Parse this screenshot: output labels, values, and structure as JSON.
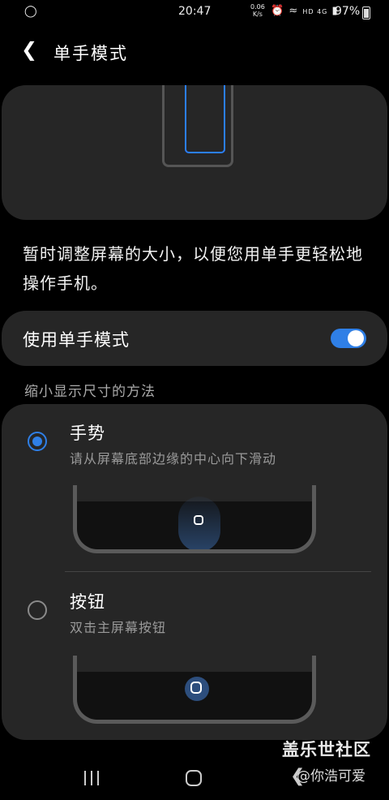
{
  "status_bar": {
    "time": "20:47",
    "network_speed_value": "0.06",
    "network_speed_unit": "K/s",
    "network_label": "HD 4G",
    "battery": "97%",
    "icons": [
      "notification-app-icon",
      "alarm-icon",
      "mute-icon",
      "wifi-icon",
      "signal-icon",
      "battery-icon"
    ]
  },
  "header": {
    "title": "单手模式"
  },
  "description": "暂时调整屏幕的大小，以便您用单手更轻松地操作手机。",
  "toggle": {
    "label": "使用单手模式",
    "state": true,
    "accent_color": "#2f7fe6"
  },
  "section": {
    "header": "缩小显示尺寸的方法"
  },
  "options": [
    {
      "title": "手势",
      "subtitle": "请从屏幕底部边缘的中心向下滑动",
      "selected": true
    },
    {
      "title": "按钮",
      "subtitle": "双击主屏幕按钮",
      "selected": false
    }
  ],
  "watermark": {
    "title": "盖乐世社区",
    "user": "@你浩可爱"
  }
}
